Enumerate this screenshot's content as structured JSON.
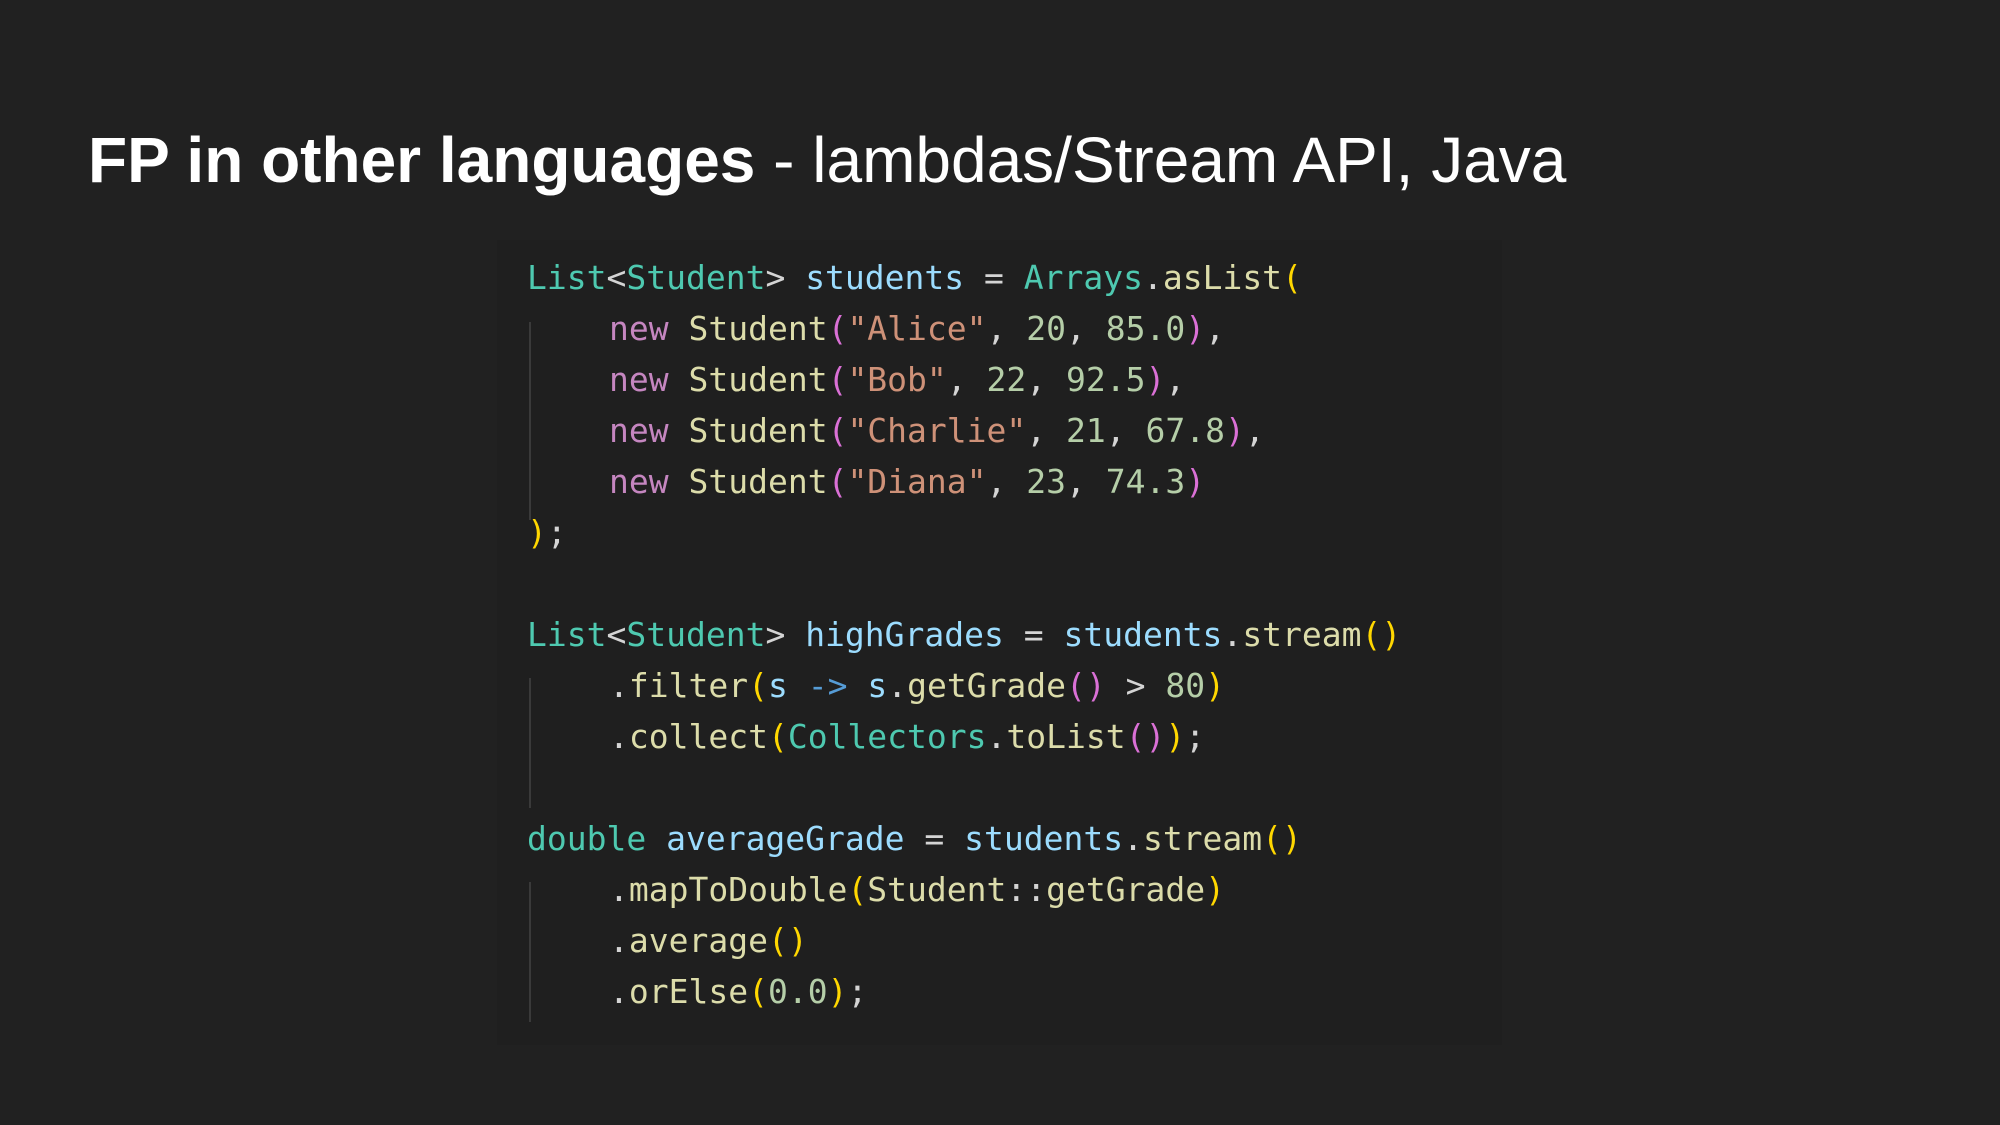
{
  "slide": {
    "title_bold": "FP in other languages",
    "title_rest": " - lambdas/Stream API, Java"
  },
  "code": {
    "list_type": "List",
    "student_type": "Student",
    "arrays_class": "Arrays",
    "as_list_fn": "asList",
    "new_keyword": "new",
    "students_var": "students",
    "students": [
      {
        "name": "\"Alice\"",
        "age": "20",
        "grade": "85.0"
      },
      {
        "name": "\"Bob\"",
        "age": "22",
        "grade": "92.5"
      },
      {
        "name": "\"Charlie\"",
        "age": "21",
        "grade": "67.8"
      },
      {
        "name": "\"Diana\"",
        "age": "23",
        "grade": "74.3"
      }
    ],
    "high_grades_var": "highGrades",
    "stream_fn": "stream",
    "filter_fn": "filter",
    "lambda_param": "s",
    "lambda_target": "s",
    "get_grade_fn": "getGrade",
    "threshold": "80",
    "collect_fn": "collect",
    "collectors_class": "Collectors",
    "to_list_fn": "toList",
    "double_keyword": "double",
    "average_grade_var": "averageGrade",
    "map_to_double_fn": "mapToDouble",
    "method_ref_target": "getGrade",
    "average_fn": "average",
    "or_else_fn": "orElse",
    "default_value": "0.0"
  }
}
